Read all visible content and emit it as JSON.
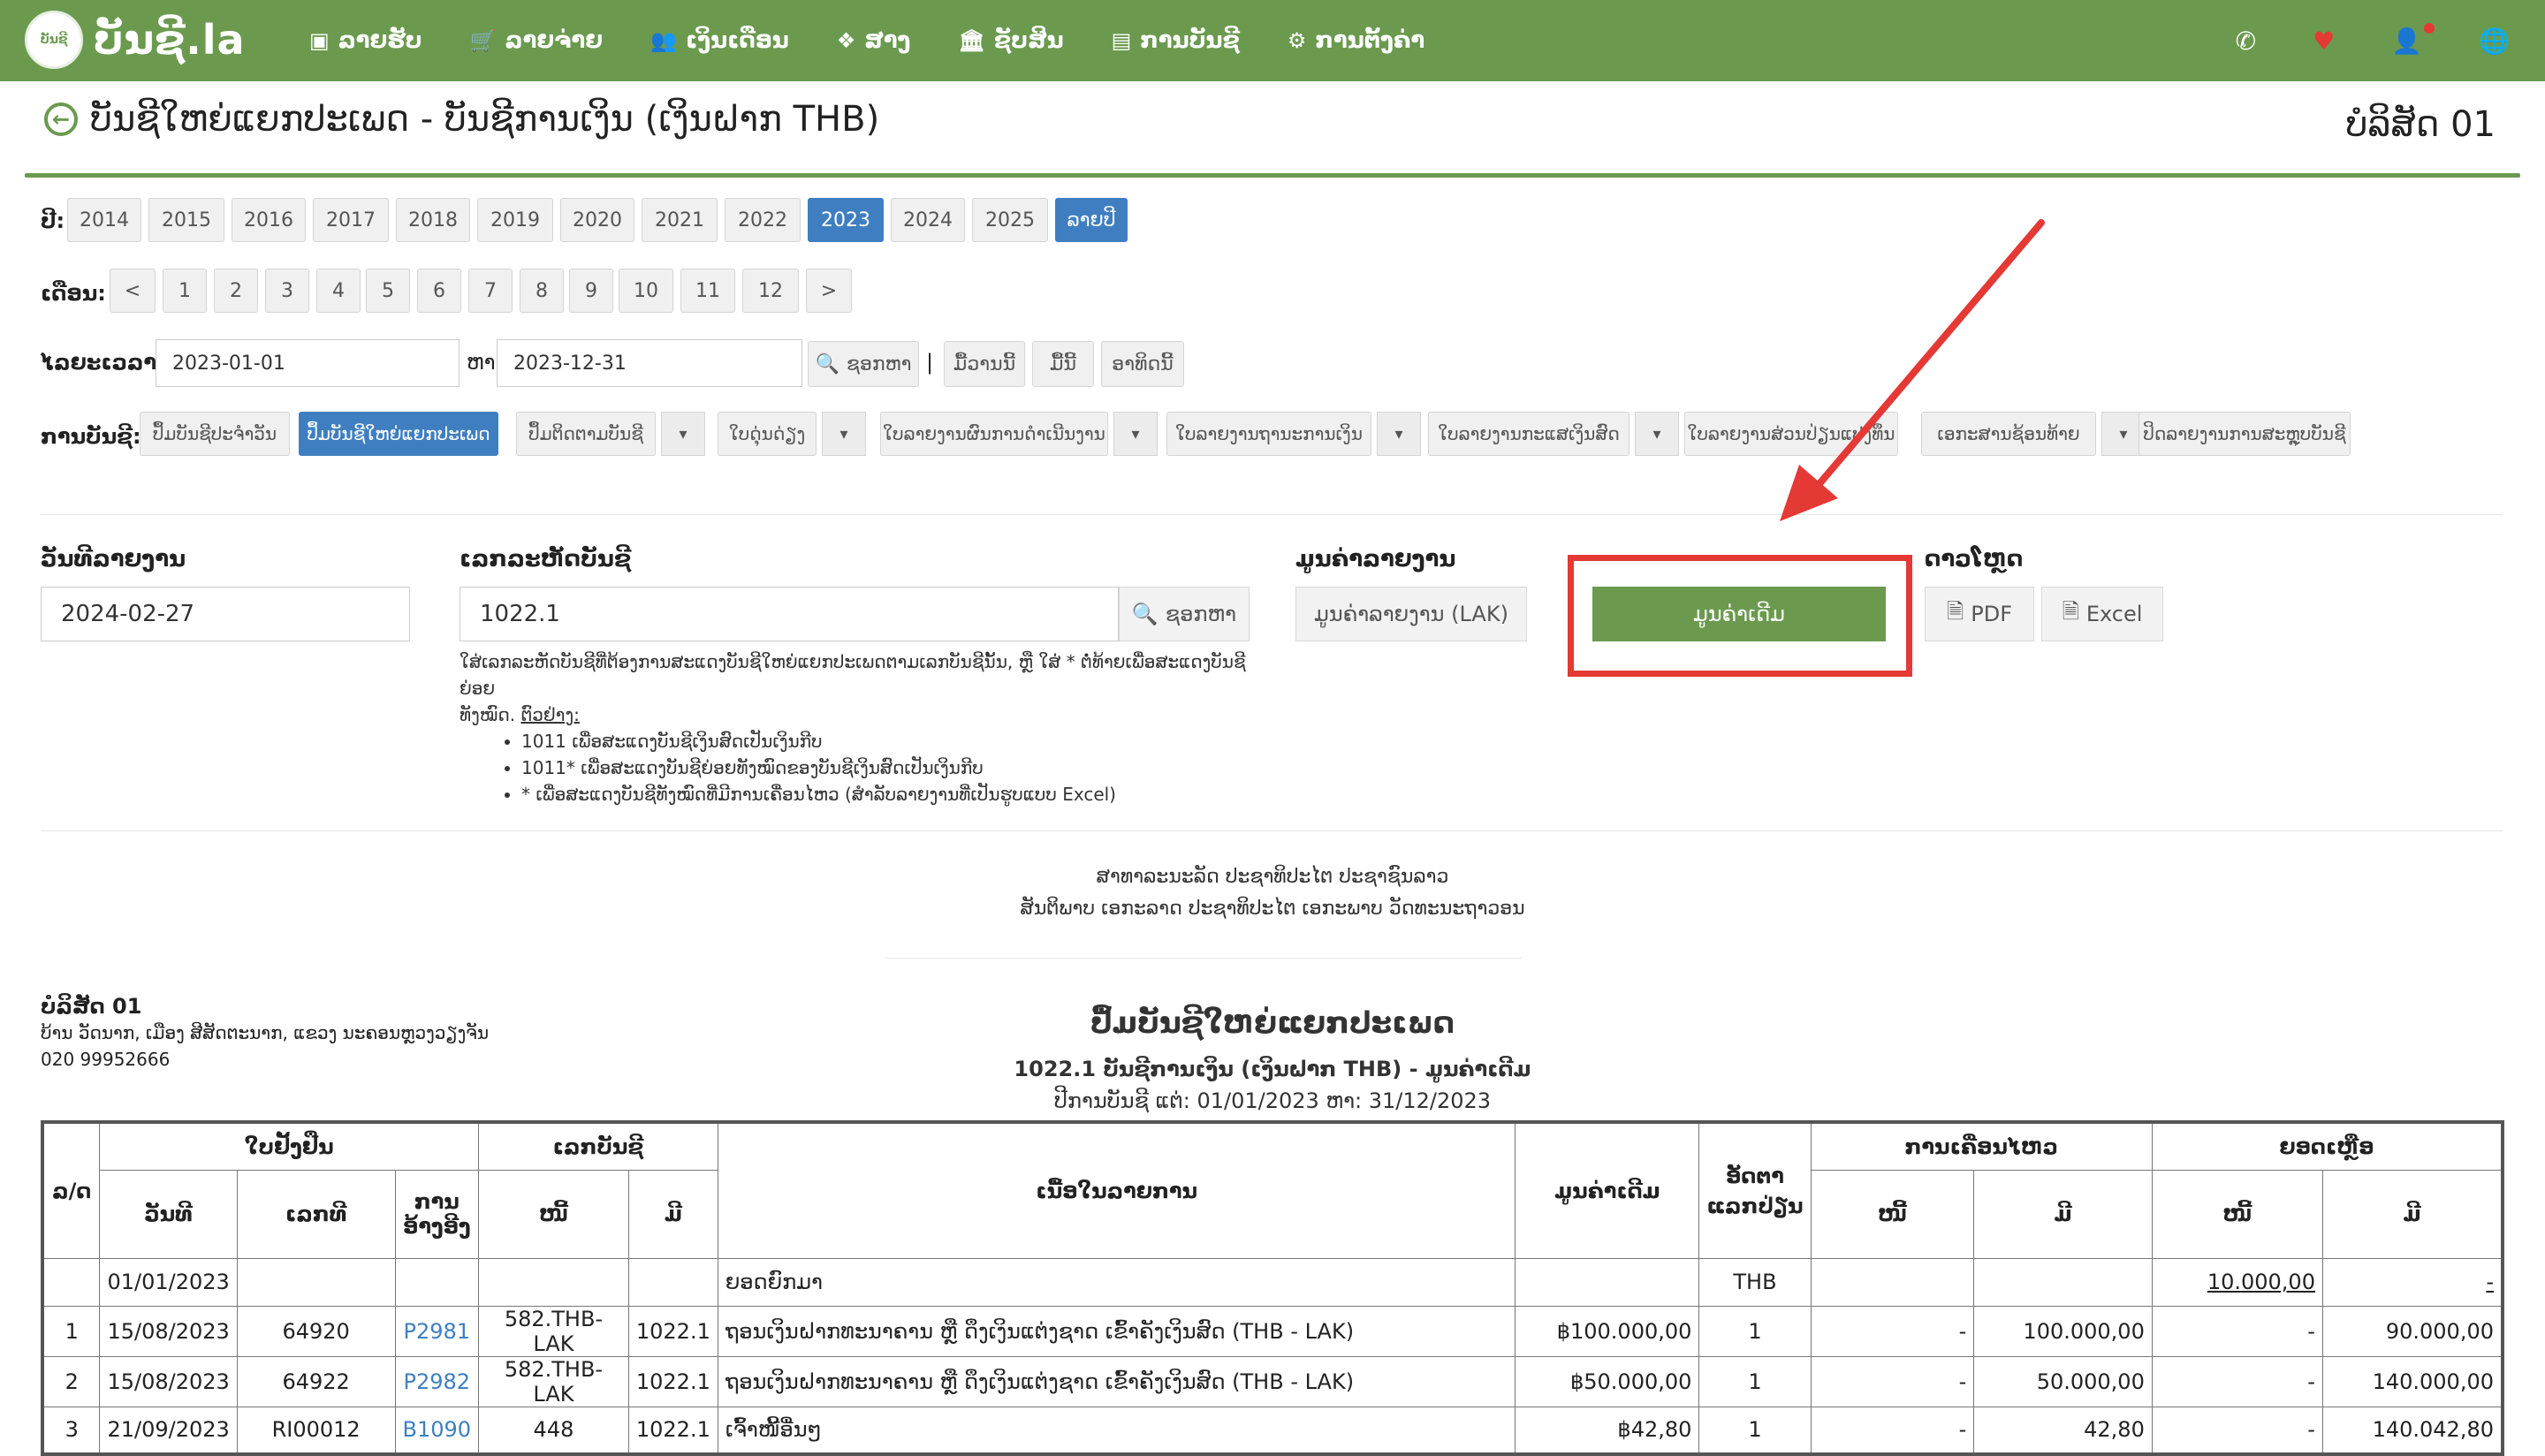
{
  "brand": {
    "logo_text": "ບັນຊີ.la",
    "logo_mark": "ບັນຊີ"
  },
  "nav": {
    "items": [
      {
        "label": "ລາຍຮັບ",
        "icon": "money-icon",
        "glyph": "▣"
      },
      {
        "label": "ລາຍຈ່າຍ",
        "icon": "cart-icon",
        "glyph": "🛒"
      },
      {
        "label": "ເງິນເດືອນ",
        "icon": "users-icon",
        "glyph": "👥"
      },
      {
        "label": "ສາງ",
        "icon": "dropbox-icon",
        "glyph": "❖"
      },
      {
        "label": "ຊັບສິນ",
        "icon": "bank-icon",
        "glyph": "🏛"
      },
      {
        "label": "ການບັນຊີ",
        "icon": "book-icon",
        "glyph": "▤"
      },
      {
        "label": "ການຕັ້ງຄ່າ",
        "icon": "gears-icon",
        "glyph": "⚙"
      }
    ]
  },
  "page": {
    "title": "ບັນຊີໃຫຍ່ແຍກປະເພດ - ບັນຊີການເງິນ (ເງິນຝາກ THB)",
    "company": "ບໍລິສັດ 01"
  },
  "filters": {
    "year_label": "ປີ:",
    "years": [
      "2014",
      "2015",
      "2016",
      "2017",
      "2018",
      "2019",
      "2020",
      "2021",
      "2022",
      "2023",
      "2024",
      "2025"
    ],
    "selected_year": "2023",
    "annual_label": "ລາຍປີ",
    "month_label": "ເດືອນ:",
    "months": [
      "<",
      "1",
      "2",
      "3",
      "4",
      "5",
      "6",
      "7",
      "8",
      "9",
      "10",
      "11",
      "12",
      ">"
    ],
    "period_label": "ໄລຍະເວລາ:",
    "date_from": "2023-01-01",
    "to_label": "ຫາ",
    "date_to": "2023-12-31",
    "search_label": "ຊອກຫາ",
    "sep": "|",
    "yesterday": "ມື້ວານນີ້",
    "today": "ມື້ນີ້",
    "this_week": "ອາທິດນີ້",
    "books_label": "ການບັນຊີ:",
    "books": [
      "ປຶ້ມບັນຊີປະຈໍາວັນ",
      "ປຶ້ມບັນຊີໃຫຍ່ແຍກປະເພດ",
      "ປຶ້ມຕິດຕາມບັນຊີ",
      "ໃບດຸ່ນດ່ຽງ",
      "ໃບລາຍງານຜົນການດໍາເນີນງານ",
      "ໃບລາຍງານຖານະການເງິນ",
      "ໃບລາຍງານກະແສເງິນສົດ",
      "ໃບລາຍງານສ່ວນປ່ຽນແປງທຶນ",
      "ເອກະສານຊ້ອນທ້າຍ",
      "ປິດລາຍງານການສະຫຼຸບບັນຊີ"
    ]
  },
  "form": {
    "report_date_label": "ວັນທີລາຍງານ",
    "report_date": "2024-02-27",
    "account_label": "ເລກລະຫັດບັນຊີ",
    "account_value": "1022.1",
    "search_label": "ຊອກຫາ",
    "help_line1": "ໃສ່ເລກລະຫັດບັນຊີທີ່ຕ້ອງການສະແດງບັນຊີໃຫຍ່ແຍກປະເພດຕາມເລກບັນຊີນັ້ນ, ຫຼື ໃສ່ * ຕໍ່ທ້າຍເພື່ອສະແດງບັນຊີຍ່ອຍ",
    "help_line2": "ທັງໝົດ.",
    "help_example": "ຕົວຢ່າງ:",
    "help_items": [
      "1011 ເພື່ອສະແດງບັນຊີເງິນສົດເປັນເງິນກີບ",
      "1011* ເພື່ອສະແດງບັນຊີຍ່ອຍທັງໝົດຂອງບັນຊີເງິນສົດເປັນເງິນກີບ",
      "* ເພື່ອສະແດງບັນຊີທັງໝົດທີ່ມີການເຄື່ອນໄຫວ (ສໍາລັບລາຍງານທີ່ເປັນຮູບແບບ Excel)"
    ],
    "value_label": "ມູນຄ່າລາຍງານ",
    "value_lak": "ມູນຄ່າລາຍງານ (LAK)",
    "value_original": "ມູນຄ່າເດີມ",
    "download_label": "ດາວໂຫຼດ",
    "pdf": "PDF",
    "excel": "Excel"
  },
  "report": {
    "nation_line1": "ສາທາລະນະລັດ ປະຊາທິປະໄຕ ປະຊາຊົນລາວ",
    "nation_line2": "ສັນຕິພາບ ເອກະລາດ ປະຊາທິປະໄຕ ເອກະພາບ ວັດທະນະຖາວອນ",
    "company_name": "ບໍລິສັດ 01",
    "company_address": "ບ້ານ ວັດນາກ, ເມືອງ ສີສັດຕະນາກ, ແຂວງ ນະຄອນຫຼວງວຽງຈັນ",
    "company_phone": "020 99952666",
    "title": "ປຶ້ມບັນຊີໃຫຍ່ແຍກປະເພດ",
    "subtitle": "1022.1 ບັນຊີການເງິນ (ເງິນຝາກ THB) - ມູນຄ່າເດີມ",
    "period": "ປີການບັນຊີ ແຕ່: 01/01/2023 ຫາ: 31/12/2023",
    "headers": {
      "no": "ລ/ດ",
      "voucher": "ໃບຢັ້ງຢືນ",
      "date": "ວັນທີ",
      "number": "ເລກທີ",
      "ref": "ການອ້າງອີງ",
      "account_no": "ເລກບັນຊີ",
      "debit": "ໜີ້",
      "credit": "ມີ",
      "description": "ເນື້ອໃນລາຍການ",
      "original_value": "ມູນຄ່າເດີມ",
      "rate": "ອັດຕາແລກປ່ຽນ",
      "movement": "ການເຄື່ອນໄຫວ",
      "balance": "ຍອດເຫຼືອ"
    },
    "opening": {
      "date": "01/01/2023",
      "desc": "ຍອດຍົກມາ",
      "rate": "THB",
      "bal_debit": "10.000,00",
      "bal_credit": "-"
    },
    "rows": [
      {
        "no": "1",
        "date": "15/08/2023",
        "number": "64920",
        "ref": "P2981",
        "acc_debit": "582.THB-LAK",
        "acc_credit": "1022.1",
        "desc": "ຖອນເງິນຝາກທະນາຄານ ຫຼື ດຶງເງິນແຕ່ງຊາດ ເຂົ້າຄັງເງິນສົດ (THB - LAK)",
        "orig": "฿100.000,00",
        "rate": "1",
        "mv_debit": "-",
        "mv_credit": "100.000,00",
        "bal_debit": "-",
        "bal_credit": "90.000,00"
      },
      {
        "no": "2",
        "date": "15/08/2023",
        "number": "64922",
        "ref": "P2982",
        "acc_debit": "582.THB-LAK",
        "acc_credit": "1022.1",
        "desc": "ຖອນເງິນຝາກທະນາຄານ ຫຼື ດຶງເງິນແຕ່ງຊາດ ເຂົ້າຄັງເງິນສົດ (THB - LAK)",
        "orig": "฿50.000,00",
        "rate": "1",
        "mv_debit": "-",
        "mv_credit": "50.000,00",
        "bal_debit": "-",
        "bal_credit": "140.000,00"
      },
      {
        "no": "3",
        "date": "21/09/2023",
        "number": "RI00012",
        "ref": "B1090",
        "acc_debit": "448",
        "acc_credit": "1022.1",
        "desc": "ເຈົ້າໜີ້ອື່ນໆ",
        "orig": "฿42,80",
        "rate": "1",
        "mv_debit": "-",
        "mv_credit": "42,80",
        "bal_debit": "-",
        "bal_credit": "140.042,80"
      }
    ]
  }
}
